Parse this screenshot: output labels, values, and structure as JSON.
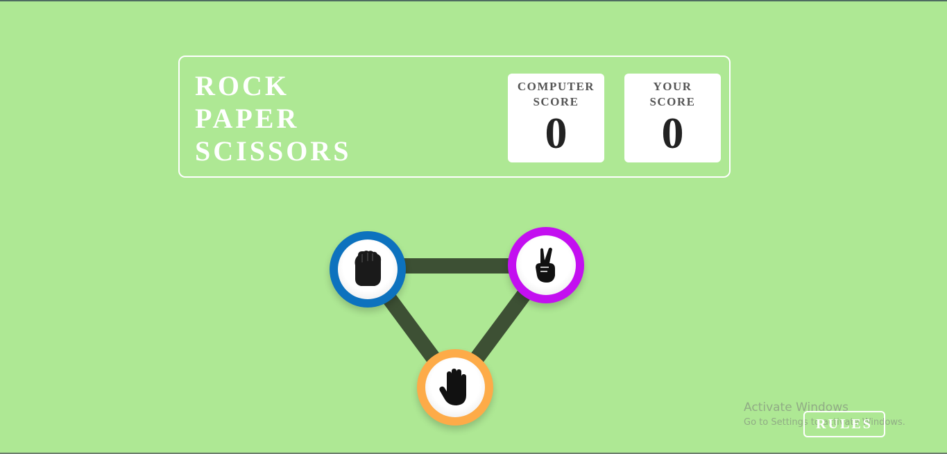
{
  "header": {
    "title_lines": [
      "ROCK",
      "PAPER",
      "SCISSORS"
    ],
    "computer_score": {
      "label": "COMPUTER SCORE",
      "value": "0"
    },
    "your_score": {
      "label": "YOUR SCORE",
      "value": "0"
    }
  },
  "choices": [
    {
      "name": "rock",
      "icon": "rock-fist-icon",
      "color": "#0d72be"
    },
    {
      "name": "scissors",
      "icon": "scissors-hand-icon",
      "color": "#c30ff0"
    },
    {
      "name": "paper",
      "icon": "paper-hand-icon",
      "color": "#fdab48"
    }
  ],
  "rules_button": {
    "label": "RULES"
  },
  "watermark": {
    "title": "Activate Windows",
    "subtitle": "Go to Settings to activate Windows."
  },
  "colors": {
    "background": "#aee894",
    "connector": "#3d5034",
    "header_border": "#ffffff"
  }
}
